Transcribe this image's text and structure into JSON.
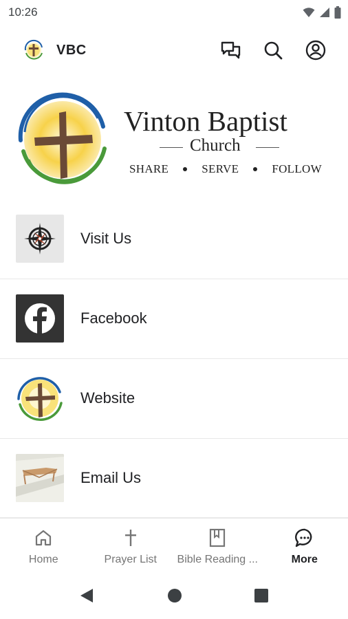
{
  "status_bar": {
    "time": "10:26",
    "icons": [
      "wifi-icon",
      "signal-icon",
      "battery-icon"
    ]
  },
  "app_bar": {
    "title": "VBC",
    "actions": [
      "chat-icon",
      "search-icon",
      "account-icon"
    ]
  },
  "banner": {
    "name": "Vinton Baptist",
    "subtitle": "Church",
    "tagline": [
      "SHARE",
      "SERVE",
      "FOLLOW"
    ]
  },
  "list": {
    "items": [
      {
        "label": "Visit Us",
        "icon": "compass-icon"
      },
      {
        "label": "Facebook",
        "icon": "facebook-icon"
      },
      {
        "label": "Website",
        "icon": "church-logo-icon"
      },
      {
        "label": "Email Us",
        "icon": "envelope-photo-icon"
      }
    ]
  },
  "bottom_nav": {
    "items": [
      {
        "label": "Home",
        "icon": "home-icon",
        "active": false
      },
      {
        "label": "Prayer List",
        "icon": "cross-icon",
        "active": false
      },
      {
        "label": "Bible Reading ...",
        "icon": "bookmark-book-icon",
        "active": false
      },
      {
        "label": "More",
        "icon": "chat-bubble-icon",
        "active": true
      }
    ]
  },
  "colors": {
    "accent_blue": "#1f5fa8",
    "accent_green": "#4a9a3a",
    "cross_brown": "#6b4a36",
    "sun_yellow": "#f7d24a"
  }
}
